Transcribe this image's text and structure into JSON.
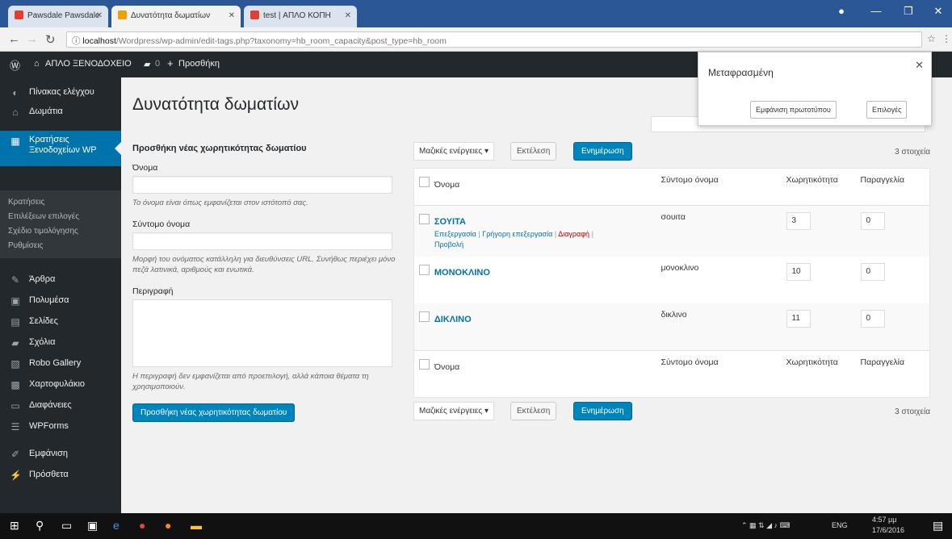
{
  "browser": {
    "tabs": [
      {
        "label": "Pawsdale Pawsdale",
        "favicon_color": "#e04030"
      },
      {
        "label": "Δυνατότητα δωματίων",
        "favicon_color": "#f0a000"
      },
      {
        "label": "test | ΑΠΛΟ ΚΟΠΗ",
        "favicon_color": "#e04030"
      }
    ],
    "url_host": "localhost",
    "url_path": "/Wordpress/wp-admin/edit-tags.php?taxonomy=hb_room_capacity&post_type=hb_room"
  },
  "adminbar": {
    "site_name": "ΑΠΛΟ ΞΕΝΟΔΟΧΕΙΟ",
    "comments_count": "0",
    "new_label": "Προσθήκη"
  },
  "sidebar": {
    "items_top": [
      {
        "label": "Πίνακας ελέγχου",
        "icon": "dashboard-icon"
      },
      {
        "label": "Δωμάτια",
        "icon": "home-icon"
      }
    ],
    "active": {
      "label": "Κρατήσεις Ξενοδοχείων WP",
      "icon": "calendar-icon"
    },
    "submenu": [
      "Κρατήσεις",
      "Επιλέξεων επιλογές",
      "Σχέδιο τιμολόγησης",
      "Ρυθμίσεις"
    ],
    "items_bottom": [
      {
        "label": "Άρθρα",
        "icon": "pin-icon"
      },
      {
        "label": "Πολυμέσα",
        "icon": "media-icon"
      },
      {
        "label": "Σελίδες",
        "icon": "pages-icon"
      },
      {
        "label": "Σχόλια",
        "icon": "comments-icon"
      },
      {
        "label": "Robo Gallery",
        "icon": "gallery-icon"
      },
      {
        "label": "Χαρτοφυλάκιο",
        "icon": "portfolio-icon"
      },
      {
        "label": "Διαφάνειες",
        "icon": "slides-icon"
      },
      {
        "label": "WPForms",
        "icon": "forms-icon"
      },
      {
        "label": "Εμφάνιση",
        "icon": "appearance-icon"
      },
      {
        "label": "Πρόσθετα",
        "icon": "plugins-icon"
      }
    ]
  },
  "page": {
    "title": "Δυνατότητα δωματίων"
  },
  "form": {
    "heading": "Προσθήκη νέας χωρητικότητας δωματίου",
    "name_label": "Όνομα",
    "name_desc": "Το όνομα είναι όπως εμφανίζεται στον ιστότοπό σας.",
    "slug_label": "Σύντομο όνομα",
    "slug_desc": "Μορφή του ονόματος κατάλληλη για διευθύνσεις URL. Συνήθως περιέχει μόνο πεζά λατινικά, αριθμούς και ενωτικά.",
    "description_label": "Περιγραφή",
    "description_desc": "Η περιγραφή δεν εμφανίζεται από προεπιλογή, αλλά κάποια θέματα τη χρησιμοποιούν.",
    "submit_label": "Προσθήκη νέας χωρητικότητας δωματίου"
  },
  "table": {
    "bulk_select": "Μαζικές ενέργειες",
    "apply_label": "Εκτέλεση",
    "update_label": "Ενημέρωση",
    "items_count": "3 στοιχεία",
    "headers": {
      "name": "Όνομα",
      "slug": "Σύντομο όνομα",
      "capacity": "Χωρητικότητα",
      "order": "Παραγγελία"
    },
    "row_actions": {
      "edit": "Επεξεργασία",
      "quick_edit": "Γρήγορη επεξεργασία",
      "delete": "Διαγραφή",
      "view": "Προβολή"
    },
    "rows": [
      {
        "name": "ΣΟΥΙΤΑ",
        "slug": "σουιτα",
        "capacity": "3",
        "order": "0"
      },
      {
        "name": "ΜΟΝΟΚΛΙΝΟ",
        "slug": "μονοκλινο",
        "capacity": "10",
        "order": "0"
      },
      {
        "name": "ΔΙΚΛΙΝΟ",
        "slug": "δικλινο",
        "capacity": "11",
        "order": "0"
      }
    ]
  },
  "translate_popup": {
    "title": "Μεταφρασμένη",
    "show_original": "Εμφάνιση πρωτοτύπου",
    "options": "Επιλογές"
  },
  "taskbar": {
    "lang": "ENG",
    "time": "4:57 μμ",
    "date": "17/6/2016"
  }
}
